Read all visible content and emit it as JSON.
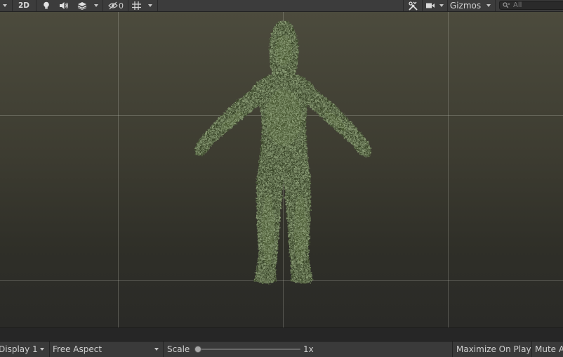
{
  "toolbar": {
    "view_2d_label": "2D",
    "hidden_count": "0",
    "gizmos_label": "Gizmos",
    "search_placeholder": "All"
  },
  "game_bar": {
    "display_label": "Display 1",
    "aspect_label": "Free Aspect",
    "scale_label": "Scale",
    "scale_value": "1x",
    "scale_fraction": 0.0,
    "maximize_label": "Maximize On Play",
    "mute_label": "Mute A"
  },
  "icons": {
    "lighting": "lightbulb-icon",
    "audio": "speaker-icon",
    "effects": "layers-icon",
    "visibility": "eye-slash-icon",
    "grid": "grid-icon",
    "tools": "tools-icon",
    "camera": "camera-icon",
    "search": "search-icon"
  },
  "colors": {
    "foliage_dark": "#2f3a22",
    "foliage_light": "#6e8348",
    "scene_top": "#4c4b3d",
    "scene_bottom": "#2a2a27"
  }
}
